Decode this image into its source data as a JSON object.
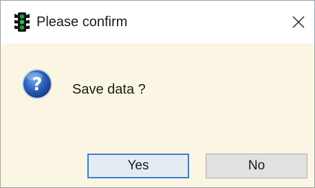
{
  "window": {
    "title": "Please confirm",
    "icon": "traffic-light-icon",
    "close_icon": "close-icon"
  },
  "dialog": {
    "icon": "question-icon",
    "message": "Save data ?"
  },
  "buttons": {
    "yes_label": "Yes",
    "no_label": "No"
  },
  "colors": {
    "content_background": "#fbf6e3",
    "titlebar_background": "#ffffff",
    "default_button_border": "#3a7bd5",
    "question_icon_blue": "#2a5fb8"
  }
}
